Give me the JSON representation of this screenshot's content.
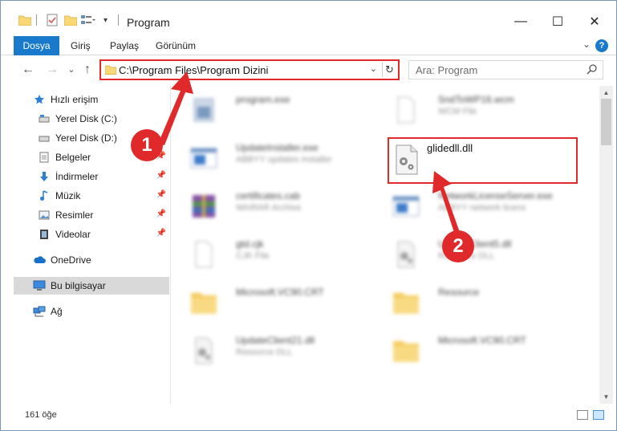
{
  "window": {
    "title": "Program",
    "controls": {
      "minimize": "—",
      "maximize": "☐",
      "close": "✕"
    }
  },
  "ribbon": {
    "tabs": [
      "Dosya",
      "Giriş",
      "Paylaş",
      "Görünüm"
    ],
    "help": "?",
    "collapse": "⌄"
  },
  "navbar": {
    "back": "←",
    "forward": "→",
    "recent": "⌄",
    "up": "↑",
    "address": "C:\\Program Files\\Program Dizini",
    "address_dropdown": "⌄",
    "refresh": "↻",
    "search_placeholder": "Ara: Program"
  },
  "sidebar": {
    "items": [
      {
        "label": "Hızlı erişim",
        "icon": "star-icon",
        "pinned": false
      },
      {
        "label": "Yerel Disk (C:)",
        "icon": "drive-icon",
        "pinned": false
      },
      {
        "label": "Yerel Disk (D:)",
        "icon": "drive-icon",
        "pinned": false
      },
      {
        "label": "Belgeler",
        "icon": "documents-icon",
        "pinned": true
      },
      {
        "label": "İndirmeler",
        "icon": "download-icon",
        "pinned": true
      },
      {
        "label": "Müzik",
        "icon": "music-icon",
        "pinned": true
      },
      {
        "label": "Resimler",
        "icon": "pictures-icon",
        "pinned": true
      },
      {
        "label": "Videolar",
        "icon": "video-icon",
        "pinned": true
      },
      {
        "label": "OneDrive",
        "icon": "cloud-icon",
        "pinned": false
      },
      {
        "label": "Bu bilgisayar",
        "icon": "computer-icon",
        "pinned": false
      },
      {
        "label": "Ağ",
        "icon": "network-icon",
        "pinned": false
      }
    ]
  },
  "files": [
    {
      "name": "program.exe",
      "type": "",
      "icon": "installer-icon",
      "blurred": true
    },
    {
      "name": "SndToWP16.wcm",
      "type": "WCM File",
      "icon": "blank-file-icon",
      "blurred": true
    },
    {
      "name": "UpdateInstaller.exe",
      "type": "ABBYY updates installer",
      "icon": "app-icon",
      "blurred": true
    },
    {
      "name": "glidedll.dll",
      "type": "",
      "icon": "dll-gear-icon",
      "blurred": false
    },
    {
      "name": "certificates.cab",
      "type": "WinRAR Archive",
      "icon": "archive-icon",
      "blurred": true
    },
    {
      "name": "NetworkLicenseServer.exe",
      "type": "ABBYY network licens",
      "icon": "app-icon",
      "blurred": true
    },
    {
      "name": "gtd.cjk",
      "type": "CJK File",
      "icon": "blank-file-icon",
      "blurred": true
    },
    {
      "name": "UpdateClient5.dll",
      "type": "Resource DLL",
      "icon": "dll-gear-icon",
      "blurred": true
    },
    {
      "name": "Microsoft.VC90.CRT",
      "type": "",
      "icon": "folder-icon",
      "blurred": true
    },
    {
      "name": "Resource",
      "type": "",
      "icon": "folder-icon",
      "blurred": true
    },
    {
      "name": "UpdateClient21.dll",
      "type": "Resource DLL",
      "icon": "dll-gear-icon",
      "blurred": true
    },
    {
      "name": "Microsoft.VC90.CRT",
      "type": "",
      "icon": "folder-icon",
      "blurred": true
    }
  ],
  "annotations": {
    "step1": "1",
    "step2": "2"
  },
  "status": {
    "count": "161 öğe"
  },
  "colors": {
    "accent": "#1979ca",
    "annotation": "#e0292b",
    "selected": "#d9d9d9"
  }
}
